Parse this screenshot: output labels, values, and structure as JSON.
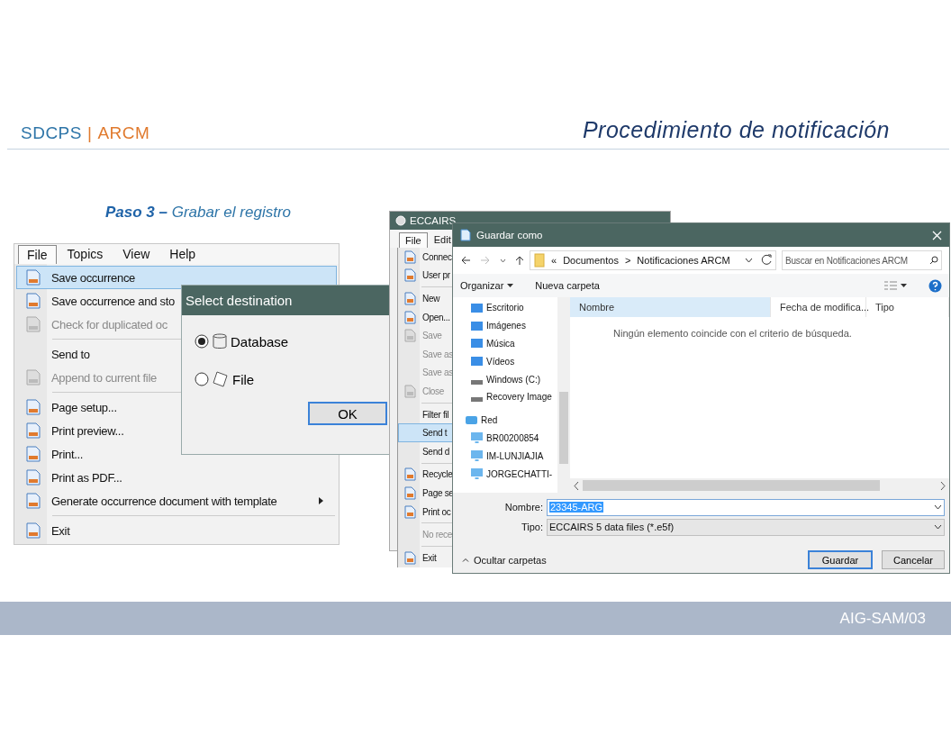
{
  "header": {
    "brand": "SDCPS",
    "separator": "|",
    "brand_suffix": "ARCM",
    "title": "Procedimiento de notificación"
  },
  "step_caption": "**Paso 3 –** Grabar el registro",
  "menu_screenshot": {
    "menu_bar": [
      {
        "label": "File",
        "selected": true
      },
      {
        "label": "Topics",
        "selected": false
      },
      {
        "label": "View",
        "selected": false
      },
      {
        "label": "Help",
        "selected": false
      }
    ],
    "menu_items": [
      {
        "kind": "item",
        "label": "Save occurrence",
        "icon": true,
        "selected": true,
        "disabled": false
      },
      {
        "kind": "item",
        "label": "Save occurrence and sto",
        "icon": true,
        "selected": false,
        "disabled": false
      },
      {
        "kind": "item",
        "label": "Check for duplicated oc",
        "icon": true,
        "selected": false,
        "disabled": true
      },
      {
        "kind": "separator"
      },
      {
        "kind": "item",
        "label": "Send to",
        "icon": false,
        "selected": false,
        "disabled": false
      },
      {
        "kind": "item",
        "label": "Append to current file",
        "icon": true,
        "selected": false,
        "disabled": true
      },
      {
        "kind": "separator"
      },
      {
        "kind": "item",
        "label": "Page setup...",
        "icon": true,
        "selected": false,
        "disabled": false
      },
      {
        "kind": "item",
        "label": "Print preview...",
        "icon": true,
        "selected": false,
        "disabled": false
      },
      {
        "kind": "item",
        "label": "Print...",
        "icon": true,
        "selected": false,
        "disabled": false
      },
      {
        "kind": "item",
        "label": "Print as PDF...",
        "icon": true,
        "selected": false,
        "disabled": false
      },
      {
        "kind": "item",
        "label": "Generate occurrence document with template",
        "icon": true,
        "selected": false,
        "disabled": false,
        "submenu": true
      },
      {
        "kind": "separator"
      },
      {
        "kind": "item",
        "label": "Exit",
        "icon": true,
        "selected": false,
        "disabled": false
      }
    ]
  },
  "select_destination": {
    "title": "Select destination",
    "options": [
      {
        "label": "Database",
        "selected": true
      },
      {
        "label": "File",
        "selected": false
      }
    ],
    "button": "OK"
  },
  "eccairs_window": {
    "title": "ECCAIRS",
    "menu_bar": [
      {
        "label": "File",
        "selected": true
      },
      {
        "label": "Edit",
        "selected": false
      }
    ],
    "menu_items": [
      {
        "kind": "item",
        "label": "Connec",
        "icon": true,
        "selected": false,
        "disabled": false
      },
      {
        "kind": "item",
        "label": "User pr",
        "icon": true,
        "selected": false,
        "disabled": false
      },
      {
        "kind": "separator"
      },
      {
        "kind": "item",
        "label": "New",
        "icon": true,
        "selected": false,
        "disabled": false
      },
      {
        "kind": "item",
        "label": "Open...",
        "icon": true,
        "selected": false,
        "disabled": false
      },
      {
        "kind": "item",
        "label": "Save",
        "icon": true,
        "selected": false,
        "disabled": true
      },
      {
        "kind": "item",
        "label": "Save as",
        "icon": false,
        "selected": false,
        "disabled": true
      },
      {
        "kind": "item",
        "label": "Save as",
        "icon": false,
        "selected": false,
        "disabled": true
      },
      {
        "kind": "item",
        "label": "Close",
        "icon": true,
        "selected": false,
        "disabled": true
      },
      {
        "kind": "separator"
      },
      {
        "kind": "item",
        "label": "Filter fil",
        "icon": false,
        "selected": false,
        "disabled": false
      },
      {
        "kind": "item",
        "label": "Send t",
        "icon": false,
        "selected": true,
        "disabled": false
      },
      {
        "kind": "item",
        "label": "Send d",
        "icon": false,
        "selected": false,
        "disabled": false
      },
      {
        "kind": "separator"
      },
      {
        "kind": "item",
        "label": "Recycle",
        "icon": true,
        "selected": false,
        "disabled": false
      },
      {
        "kind": "item",
        "label": "Page se",
        "icon": true,
        "selected": false,
        "disabled": false
      },
      {
        "kind": "item",
        "label": "Print oc",
        "icon": true,
        "selected": false,
        "disabled": false
      },
      {
        "kind": "separator"
      },
      {
        "kind": "item",
        "label": "No rece",
        "icon": false,
        "selected": false,
        "disabled": true
      },
      {
        "kind": "separator"
      },
      {
        "kind": "item",
        "label": "Exit",
        "icon": true,
        "selected": false,
        "disabled": false
      }
    ]
  },
  "save_dialog": {
    "title": "Guardar como",
    "breadcrumb": {
      "prefix": "«",
      "parts": [
        "Documentos",
        "Notificaciones ARCM"
      ],
      "divider": ">"
    },
    "search": {
      "placeholder": "Buscar en Notificaciones ARCM"
    },
    "toolbar": {
      "organize": "Organizar",
      "new_folder": "Nueva carpeta"
    },
    "nav_items": [
      {
        "kind": "location",
        "label": "Escritorio"
      },
      {
        "kind": "location",
        "label": "Imágenes"
      },
      {
        "kind": "location",
        "label": "Música"
      },
      {
        "kind": "location",
        "label": "Vídeos"
      },
      {
        "kind": "drive",
        "label": "Windows (C:)"
      },
      {
        "kind": "drive",
        "label": "Recovery Image"
      },
      {
        "kind": "network",
        "label": "Red"
      },
      {
        "kind": "computer",
        "label": "BR00200854"
      },
      {
        "kind": "computer",
        "label": "IM-LUNJIAJIA"
      },
      {
        "kind": "computer",
        "label": "JORGECHATTI-"
      }
    ],
    "columns": [
      {
        "label": "Nombre",
        "selected": true
      },
      {
        "label": "Fecha de modifica...",
        "selected": false
      },
      {
        "label": "Tipo",
        "selected": false
      }
    ],
    "empty_message": "Ningún elemento coincide con el criterio de búsqueda.",
    "name_label": "Nombre:",
    "name_value": "23345-ARG",
    "type_label": "Tipo:",
    "type_value": "ECCAIRS 5 data files (*.e5f)",
    "hide_folders": "Ocultar carpetas",
    "buttons": [
      {
        "label": "Guardar",
        "selected": true
      },
      {
        "label": "Cancelar",
        "selected": false
      }
    ]
  },
  "footer": {
    "code": "AIG-SAM/03"
  }
}
